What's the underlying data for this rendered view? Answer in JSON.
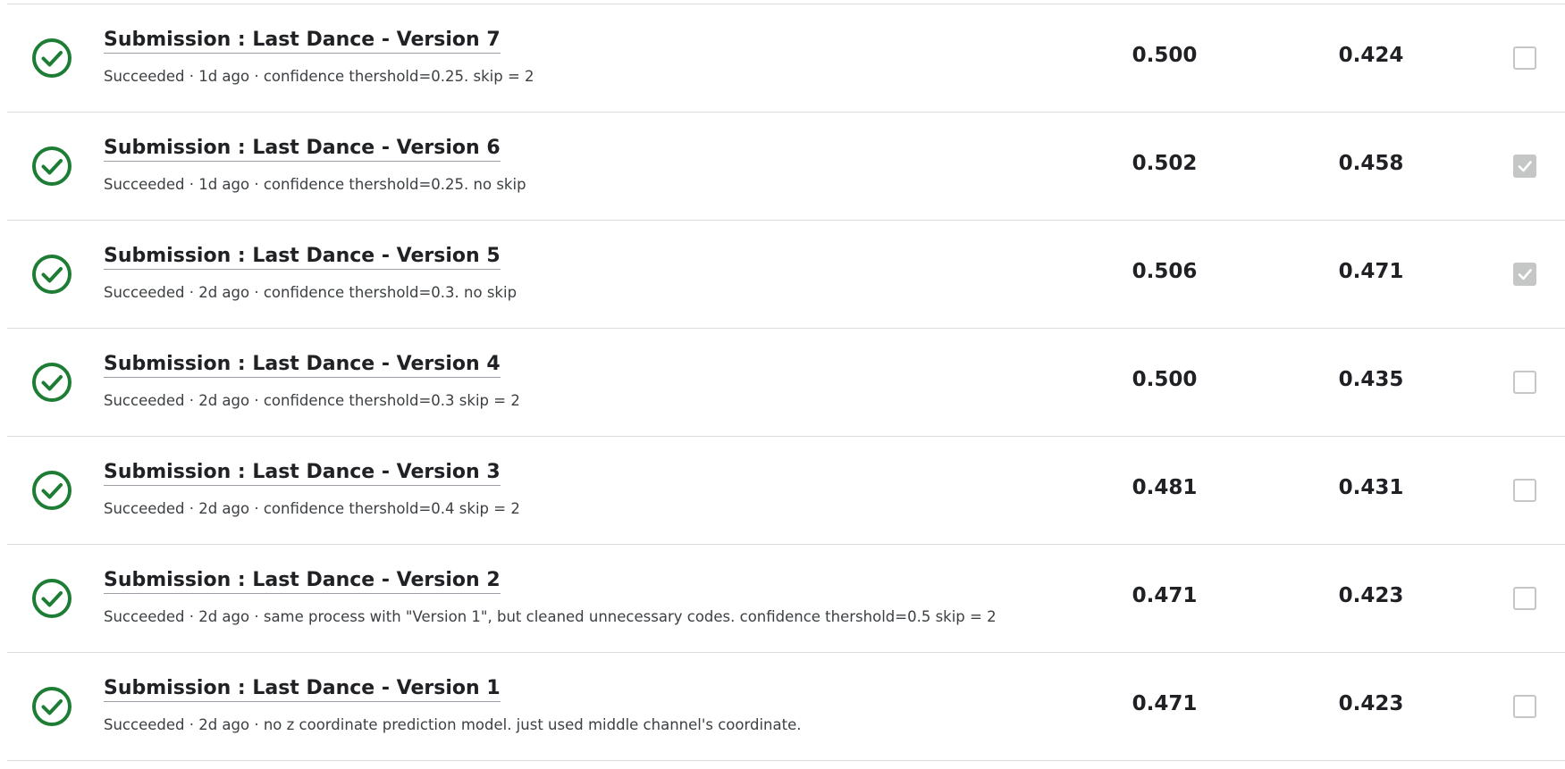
{
  "colors": {
    "success_green": "#1e7d34",
    "divider": "#dadce0",
    "checkbox_checked_fill": "#c4c7c5"
  },
  "icons": {
    "status": "check-circle-icon",
    "selected": "checkmark-icon"
  },
  "submissions": [
    {
      "title": "Submission : Last Dance - Version 7",
      "subtitle": "Succeeded · 1d ago · confidence thershold=0.25. skip = 2",
      "private_score": "0.500",
      "public_score": "0.424",
      "selected": false
    },
    {
      "title": "Submission : Last Dance - Version 6",
      "subtitle": "Succeeded · 1d ago · confidence thershold=0.25. no skip",
      "private_score": "0.502",
      "public_score": "0.458",
      "selected": true
    },
    {
      "title": "Submission : Last Dance - Version 5",
      "subtitle": "Succeeded · 2d ago · confidence thershold=0.3. no skip",
      "private_score": "0.506",
      "public_score": "0.471",
      "selected": true
    },
    {
      "title": "Submission : Last Dance - Version 4",
      "subtitle": "Succeeded · 2d ago · confidence thershold=0.3 skip = 2",
      "private_score": "0.500",
      "public_score": "0.435",
      "selected": false
    },
    {
      "title": "Submission : Last Dance - Version 3",
      "subtitle": "Succeeded · 2d ago · confidence thershold=0.4 skip = 2",
      "private_score": "0.481",
      "public_score": "0.431",
      "selected": false
    },
    {
      "title": "Submission : Last Dance - Version 2",
      "subtitle": "Succeeded · 2d ago · same process with \"Version 1\", but cleaned unnecessary codes. confidence thershold=0.5 skip = 2",
      "private_score": "0.471",
      "public_score": "0.423",
      "selected": false
    },
    {
      "title": "Submission : Last Dance - Version 1",
      "subtitle": "Succeeded · 2d ago · no z coordinate prediction model. just used middle channel's coordinate.",
      "private_score": "0.471",
      "public_score": "0.423",
      "selected": false
    }
  ]
}
